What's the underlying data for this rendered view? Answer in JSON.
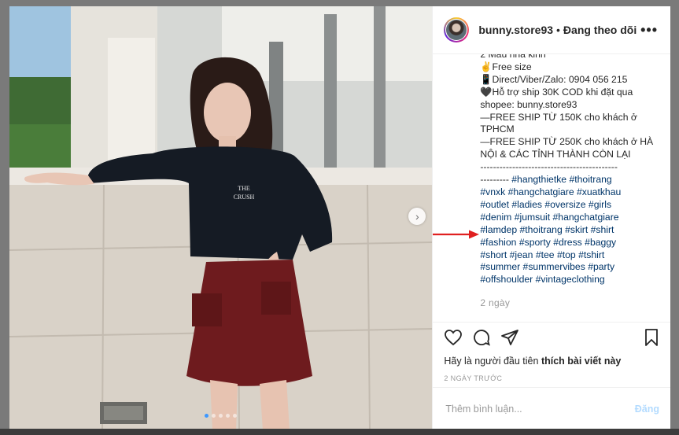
{
  "header": {
    "username": "bunny.store93",
    "separator": "•",
    "follow_status": "Đang theo dõi",
    "more_label": "•••"
  },
  "caption_lines": [
    "2 Màu nhà kinh",
    "✌Free size",
    "📱Direct/Viber/Zalo: 0904 056 215",
    "🖤Hỗ trợ ship 30K COD khi đặt qua",
    "shopee: bunny.store93",
    "—FREE SHIP TỪ 150K cho khách ở",
    "TPHCM",
    "—FREE SHIP TỪ 250K cho khách ở HÀ",
    "NỘI & CÁC TỈNH THÀNH CÒN LẠI",
    "-------------------------------------------"
  ],
  "hashtag_lines": [
    {
      "prefix": "--------- ",
      "tags": [
        "#hangthietke",
        "#thoitrang"
      ]
    },
    {
      "prefix": "",
      "tags": [
        "#vnxk",
        "#hangchatgiare",
        "#xuatkhau"
      ]
    },
    {
      "prefix": "",
      "tags": [
        "#outlet",
        "#ladies",
        "#oversize",
        "#girls"
      ]
    },
    {
      "prefix": "",
      "tags": [
        "#denim",
        "#jumsuit",
        "#hangchatgiare"
      ]
    },
    {
      "prefix": "",
      "tags": [
        "#lamdep",
        "#thoitrang",
        "#skirt",
        "#shirt"
      ]
    },
    {
      "prefix": "",
      "tags": [
        "#fashion",
        "#sporty",
        "#dress",
        "#baggy"
      ]
    },
    {
      "prefix": "",
      "tags": [
        "#short",
        "#jean",
        "#tee",
        "#top",
        "#tshirt"
      ]
    },
    {
      "prefix": "",
      "tags": [
        "#summer",
        "#summervibes",
        "#party"
      ]
    },
    {
      "prefix": "",
      "tags": [
        "#offshoulder",
        "#vintageclothing"
      ]
    }
  ],
  "caption_time": "2 ngày",
  "likes": {
    "prefix": "Hãy là người đầu tiên ",
    "bold": "thích bài viết này"
  },
  "post_date": "2 NGÀY TRƯỚC",
  "comment": {
    "placeholder": "Thêm bình luận...",
    "post_label": "Đăng"
  },
  "photo": {
    "shirt_text_line1": "THE",
    "shirt_text_line2": "CRUSH",
    "slide_count": 5,
    "active_slide": 1
  },
  "colors": {
    "hashtag": "#003569",
    "post_disabled": "#b3dbff",
    "arrow": "#e02020",
    "active_dot": "#3d98ff"
  }
}
